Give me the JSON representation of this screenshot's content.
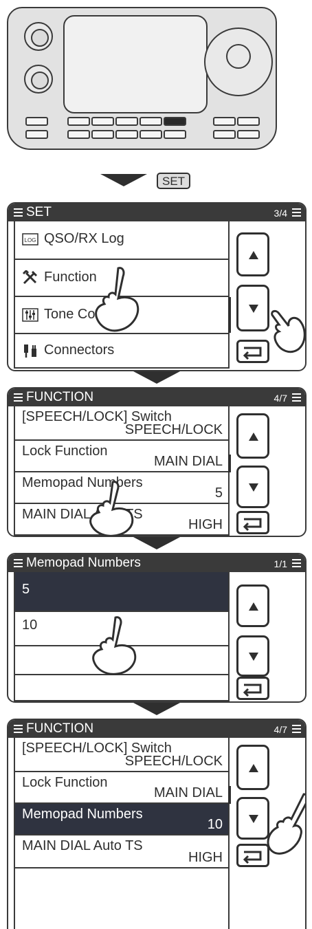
{
  "badge": {
    "set_key": "SET"
  },
  "panel_set": {
    "title": "SET",
    "page": "3/4",
    "items": [
      "QSO/RX Log",
      "Function",
      "Tone Control",
      "Connectors"
    ],
    "icons": [
      "log-icon",
      "tools-icon",
      "tone-control-icon",
      "connectors-icon"
    ]
  },
  "panel_function": {
    "title": "FUNCTION",
    "page": "4/7",
    "items": [
      {
        "name": "[SPEECH/LOCK] Switch",
        "value": "SPEECH/LOCK"
      },
      {
        "name": "Lock Function",
        "value": "MAIN DIAL"
      },
      {
        "name": "Memopad Numbers",
        "value": "5"
      },
      {
        "name": "MAIN DIAL Auto TS",
        "value": "HIGH"
      }
    ]
  },
  "panel_memopad": {
    "title": "Memopad Numbers",
    "page": "1/1",
    "options": [
      "5",
      "10"
    ]
  },
  "panel_function_after": {
    "title": "FUNCTION",
    "page": "4/7",
    "items": [
      {
        "name": "[SPEECH/LOCK] Switch",
        "value": "SPEECH/LOCK"
      },
      {
        "name": "Lock Function",
        "value": "MAIN DIAL"
      },
      {
        "name": "Memopad Numbers",
        "value": "10"
      },
      {
        "name": "MAIN DIAL Auto TS",
        "value": "HIGH"
      }
    ]
  },
  "colors": {
    "titlebar": "#3a3a3a",
    "selected_row": "#2f3340",
    "line": "#2f2f2f"
  }
}
